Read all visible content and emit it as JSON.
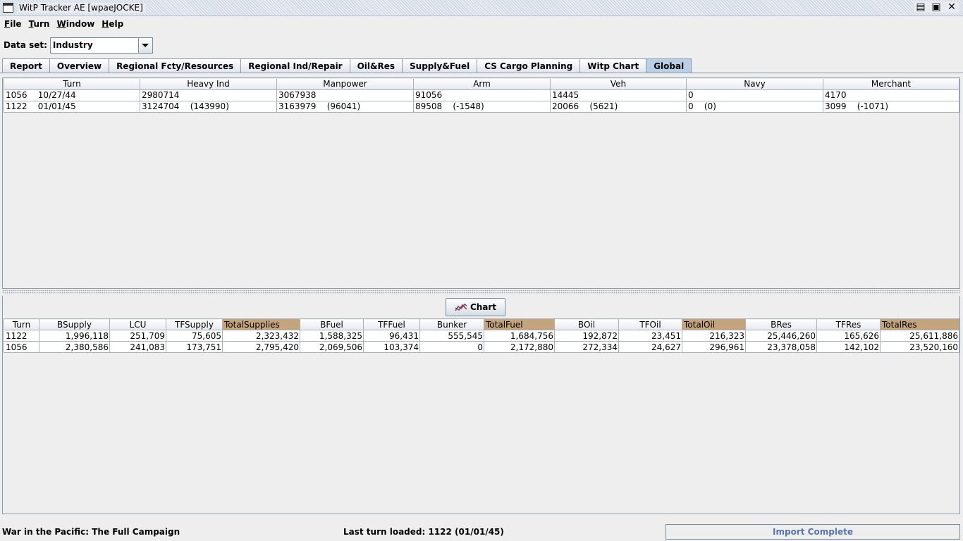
{
  "window": {
    "title": "WitP Tracker AE [wpaeJOCKE]"
  },
  "menu": [
    {
      "mnemonic": "F",
      "rest": "ile"
    },
    {
      "mnemonic": "T",
      "rest": "urn"
    },
    {
      "mnemonic": "W",
      "rest": "indow"
    },
    {
      "mnemonic": "H",
      "rest": "elp"
    }
  ],
  "dataset": {
    "label": "Data set:",
    "value": "Industry"
  },
  "tabs": [
    {
      "label": "Report",
      "active": false
    },
    {
      "label": "Overview",
      "active": false
    },
    {
      "label": "Regional Fcty/Resources",
      "active": false
    },
    {
      "label": "Regional Ind/Repair",
      "active": false
    },
    {
      "label": "Oil&Res",
      "active": false
    },
    {
      "label": "Supply&Fuel",
      "active": false
    },
    {
      "label": "CS Cargo Planning",
      "active": false
    },
    {
      "label": "Witp Chart",
      "active": false
    },
    {
      "label": "Global",
      "active": true
    }
  ],
  "industry_table": {
    "columns": [
      "Turn",
      "Heavy Ind",
      "Manpower",
      "Arm",
      "Veh",
      "Navy",
      "Merchant"
    ],
    "rows": [
      [
        "1056    10/27/44",
        "2980714",
        "3067938",
        "91056",
        "14445",
        "0",
        "4170"
      ],
      [
        "1122    01/01/45",
        "3124704    (143990)",
        "3163979    (96041)",
        "89508    (-1548)",
        "20066    (5621)",
        "0    (0)",
        "3099    (-1071)"
      ]
    ]
  },
  "chart_button": {
    "label": "Chart"
  },
  "totals_table": {
    "columns": [
      "Turn",
      "BSupply",
      "LCU",
      "TFSupply",
      "TotalSupplies",
      "BFuel",
      "TFFuel",
      "Bunker",
      "TotalFuel",
      "BOil",
      "TFOil",
      "TotalOil",
      "BRes",
      "TFRes",
      "TotalRes"
    ],
    "highlight_color": "#c4a47c",
    "rows": [
      [
        "1122",
        "1,996,118",
        "251,709",
        "75,605",
        "2,323,432",
        "1,588,325",
        "96,431",
        "555,545",
        "1,684,756",
        "192,872",
        "23,451",
        "216,323",
        "25,446,260",
        "165,626",
        "25,611,886"
      ],
      [
        "1056",
        "2,380,586",
        "241,083",
        "173,751",
        "2,795,420",
        "2,069,506",
        "103,374",
        "0",
        "2,172,880",
        "272,334",
        "24,627",
        "296,961",
        "23,378,058",
        "142,102",
        "23,520,160"
      ]
    ]
  },
  "status": {
    "game": "War in the Pacific: The Full Campaign",
    "last_turn": "Last turn loaded: 1122 (01/01/45)",
    "progress_text": "Import Complete",
    "progress_percent": 100
  }
}
